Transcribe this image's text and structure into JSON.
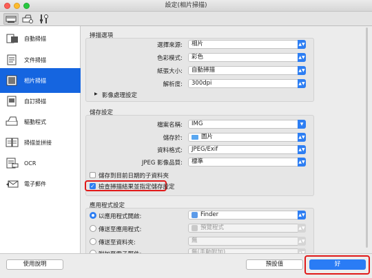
{
  "window": {
    "title": "設定(相片掃描)"
  },
  "sidebar": {
    "items": [
      {
        "label": "自動掃描",
        "icon": "auto-scan-icon"
      },
      {
        "label": "文件掃描",
        "icon": "document-scan-icon"
      },
      {
        "label": "相片掃描",
        "icon": "photo-scan-icon"
      },
      {
        "label": "自訂掃描",
        "icon": "custom-scan-icon"
      },
      {
        "label": "驅動程式",
        "icon": "driver-icon"
      },
      {
        "label": "掃描並拼接",
        "icon": "stitch-icon"
      },
      {
        "label": "OCR",
        "icon": "ocr-icon"
      },
      {
        "label": "電子郵件",
        "icon": "email-icon"
      }
    ],
    "active_index": 2
  },
  "scan_options": {
    "header": "掃描選項",
    "source": {
      "label": "選擇來源:",
      "value": "相片"
    },
    "color_mode": {
      "label": "色彩模式:",
      "value": "彩色"
    },
    "paper_size": {
      "label": "紙張大小:",
      "value": "自動掃描"
    },
    "resolution": {
      "label": "解析度:",
      "value": "300dpi"
    },
    "image_processing": "影像處理設定"
  },
  "save": {
    "header": "儲存設定",
    "file_name": {
      "label": "檔案名稱:",
      "value": "IMG"
    },
    "save_in": {
      "label": "儲存於:",
      "value": "圖片"
    },
    "data_format": {
      "label": "資料格式:",
      "value": "JPEG/Exif"
    },
    "jpeg_quality": {
      "label": "JPEG 影像品質:",
      "value": "標準"
    },
    "save_to_date_subfolder": {
      "label": "儲存到目前日期的子資料夾",
      "checked": false
    },
    "check_results": {
      "label": "檢查掃描結果並指定儲存設定",
      "checked": true
    }
  },
  "app": {
    "header": "應用程式設定",
    "open_with": {
      "label": "以應用程式開啟:",
      "value": "Finder",
      "selected": true
    },
    "send_to_app": {
      "label": "傳送至應用程式:",
      "value": "預覽程式"
    },
    "send_to_folder": {
      "label": "傳送至資料夾:",
      "value": "無"
    },
    "attach_email": {
      "label": "附加至電子郵件:",
      "value": "無(手動附加)"
    }
  },
  "buttons": {
    "help": "使用說明",
    "defaults": "預設值",
    "ok": "好"
  }
}
